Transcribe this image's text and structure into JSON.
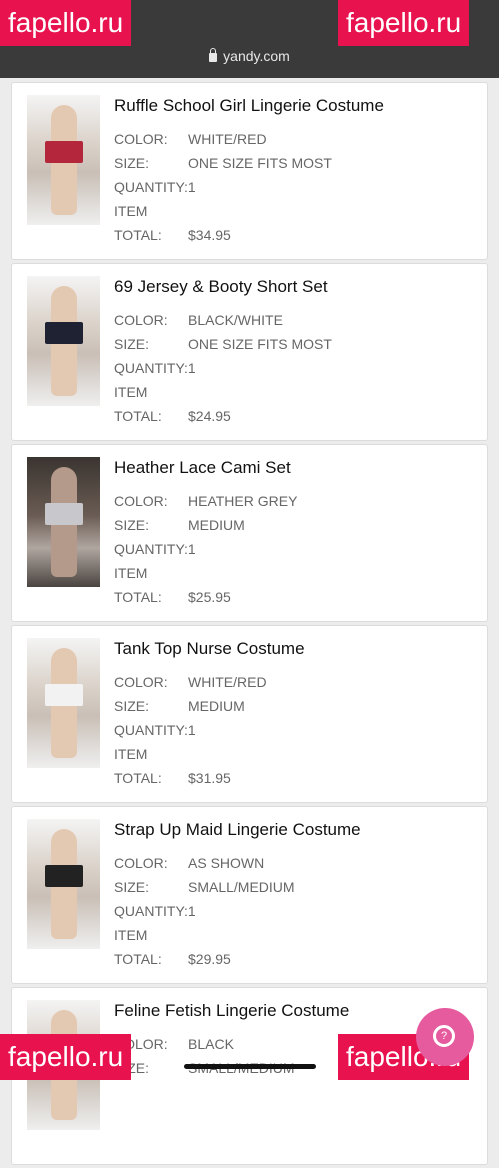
{
  "browser": {
    "url": "yandy.com",
    "status_left": "...",
    "status_right": "..."
  },
  "watermark": "fapello.ru",
  "labels": {
    "color": "COLOR:",
    "size": "SIZE:",
    "quantity": "QUANTITY:1",
    "item": "ITEM",
    "total": "TOTAL:"
  },
  "items": [
    {
      "title": "Ruffle School Girl Lingerie Costume",
      "color": "WHITE/RED",
      "size": "ONE SIZE FITS MOST",
      "total": "$34.95"
    },
    {
      "title": "69 Jersey & Booty Short Set",
      "color": "BLACK/WHITE",
      "size": "ONE SIZE FITS MOST",
      "total": "$24.95"
    },
    {
      "title": "Heather Lace Cami Set",
      "color": "HEATHER GREY",
      "size": "MEDIUM",
      "total": "$25.95"
    },
    {
      "title": "Tank Top Nurse Costume",
      "color": "WHITE/RED",
      "size": "MEDIUM",
      "total": "$31.95"
    },
    {
      "title": "Strap Up Maid Lingerie Costume",
      "color": "AS SHOWN",
      "size": "SMALL/MEDIUM",
      "total": "$29.95"
    },
    {
      "title": "Feline Fetish Lingerie Costume",
      "color": "BLACK",
      "size": "SMALL/MEDIUM",
      "total": ""
    }
  ],
  "fab_icon": "chat-icon"
}
